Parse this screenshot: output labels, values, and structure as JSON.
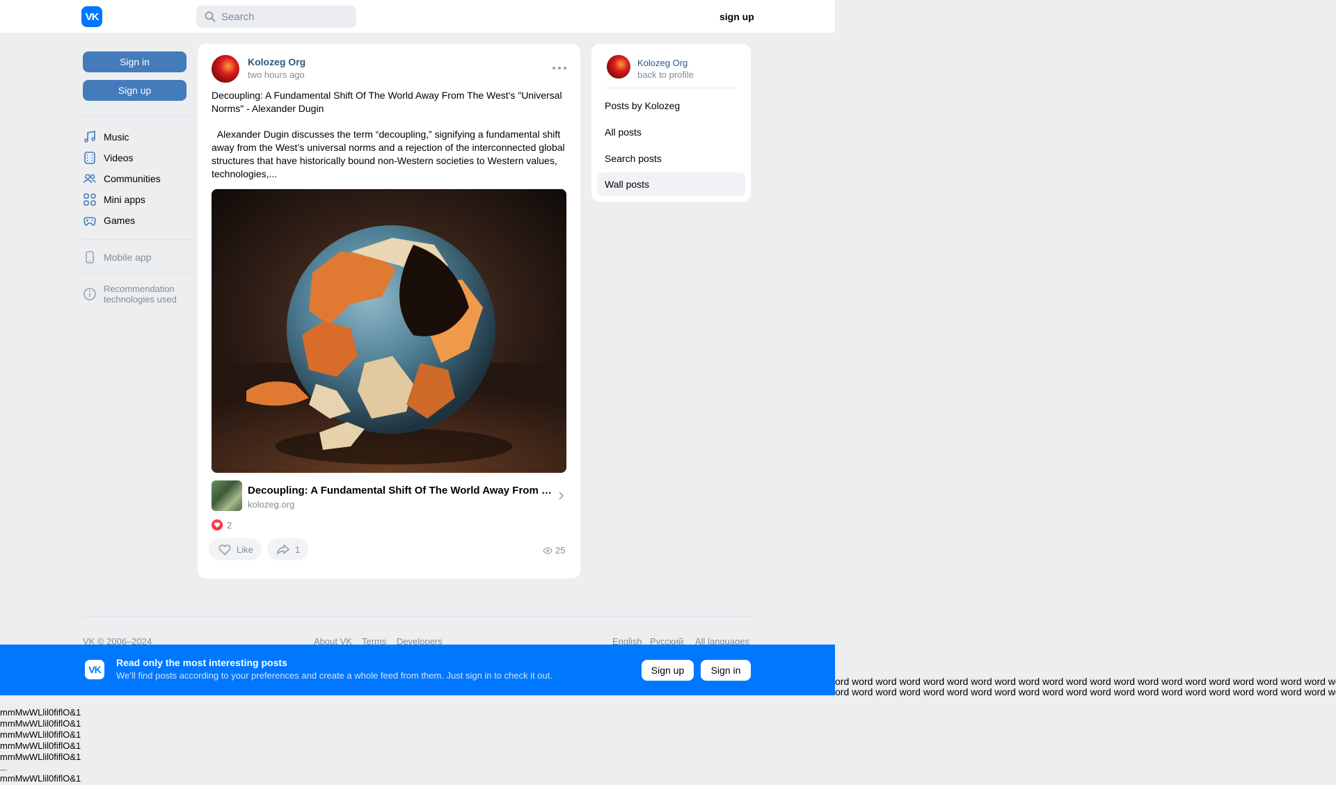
{
  "header": {
    "logo_text": "VK",
    "search_placeholder": "Search",
    "signup_link": "sign up"
  },
  "left_nav": {
    "sign_in_button": "Sign in",
    "sign_up_button": "Sign up",
    "items": [
      {
        "label": "Music",
        "icon": "music-note-icon"
      },
      {
        "label": "Videos",
        "icon": "video-film-icon"
      },
      {
        "label": "Communities",
        "icon": "users-icon"
      },
      {
        "label": "Mini apps",
        "icon": "apps-grid-icon"
      },
      {
        "label": "Games",
        "icon": "gamepad-icon"
      }
    ],
    "mobile_app": "Mobile app",
    "recommendation": "Recommendation technologies used"
  },
  "post": {
    "author": "Kolozeg Org",
    "time": "two hours ago",
    "title": "Decoupling: A Fundamental Shift Of The World Away From The West's \"Universal Norms\" - Alexander Dugin",
    "body": "  Alexander Dugin discusses the term “decoupling,” signifying a fundamental shift away from the West’s universal norms and a rejection of the interconnected global structures that have historically bound non-Western societies to Western values, technologies,...",
    "image_alt": "cracked globe with peeling paint",
    "link_title": "Decoupling: A Fundamental Shift Of The World Away From The ...",
    "link_domain": "kolozeg.org",
    "likes_count": "2",
    "like_label": "Like",
    "shares_count": "1",
    "views_count": "25"
  },
  "right_panel": {
    "author": "Kolozeg Org",
    "back": "back to profile",
    "items": [
      "Posts by Kolozeg",
      "All posts",
      "Search posts",
      "Wall posts"
    ],
    "active_item": "Wall posts"
  },
  "footer": {
    "copyright": "VK © 2006–2024",
    "links": [
      "About VK",
      "Terms",
      "Developers"
    ],
    "languages": [
      "English",
      "Русский",
      "All languages"
    ]
  },
  "banner": {
    "title": "Read only the most interesting posts",
    "subtitle": "We’ll find posts according to your preferences and create a whole feed from them. Just sign in to check it out.",
    "sign_up": "Sign up",
    "sign_in": "Sign in"
  },
  "artifacts": {
    "word_line": "ord word word word word word word word word word word word word word word word word word word word word word word word word word word word word word word word word",
    "mm_line": "mmMwWLlil0fiflO&1"
  },
  "colors": {
    "vk_blue": "#0077ff",
    "button_blue": "#447bba",
    "link_blue": "#2a5885",
    "page_bg": "#edeef0"
  }
}
